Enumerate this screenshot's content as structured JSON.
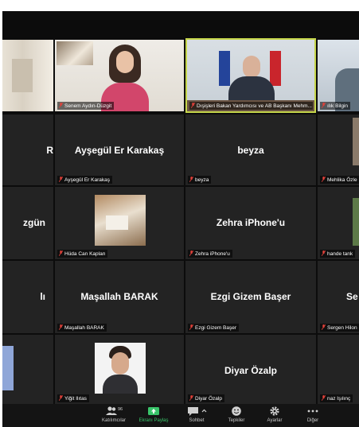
{
  "tiles": {
    "r1c0": {
      "label": ""
    },
    "r1c1": {
      "label": "Senem Aydın-Düzgit"
    },
    "r1c2": {
      "label": "Dışişleri Bakan Yardımcısı ve AB Başkanı Mehm..."
    },
    "r1c3": {
      "label": "ılık Bilgin"
    },
    "r2c0": {
      "big": "R"
    },
    "r2c1": {
      "big": "Ayşegül Er Karakaş",
      "label": "Ayşegül Er Karakaş"
    },
    "r2c2": {
      "big": "beyza",
      "label": "beyza"
    },
    "r2c3": {
      "label": "Mehlika Özle"
    },
    "r3c0": {
      "big": "zgün"
    },
    "r3c1": {
      "label": "Hüda Can Kaplan"
    },
    "r3c2": {
      "big": "Zehra iPhone'u",
      "label": "Zehra iPhone'u"
    },
    "r3c3": {
      "label": "hande tank"
    },
    "r4c0": {
      "big": "lı"
    },
    "r4c1": {
      "big": "Maşallah BARAK",
      "label": "Maşallah BARAK"
    },
    "r4c2": {
      "big": "Ezgi Gizem Başer",
      "label": "Ezgi Gizem Başer"
    },
    "r4c3": {
      "big": "Se",
      "label": "Sergen Hilon"
    },
    "r5c1": {
      "label": "Yiğit Ilıtas"
    },
    "r5c2": {
      "big": "Diyar Özalp",
      "label": "Diyar Özalp"
    },
    "r5c3": {
      "label": "naz Işılınç"
    }
  },
  "toolbar": {
    "participants": {
      "label": "Katılımcılar",
      "count": "96"
    },
    "share": {
      "label": "Ekranı Paylaş"
    },
    "chat": {
      "label": "Sohbet"
    },
    "reactions": {
      "label": "Tepkiler"
    },
    "settings": {
      "label": "Ayarlar"
    },
    "more": {
      "label": "Diğer"
    }
  },
  "colors": {
    "active_speaker_border": "#c6d64a",
    "muted_icon": "#e0413a",
    "share_green": "#39c46a",
    "tile_bg": "#232323"
  }
}
